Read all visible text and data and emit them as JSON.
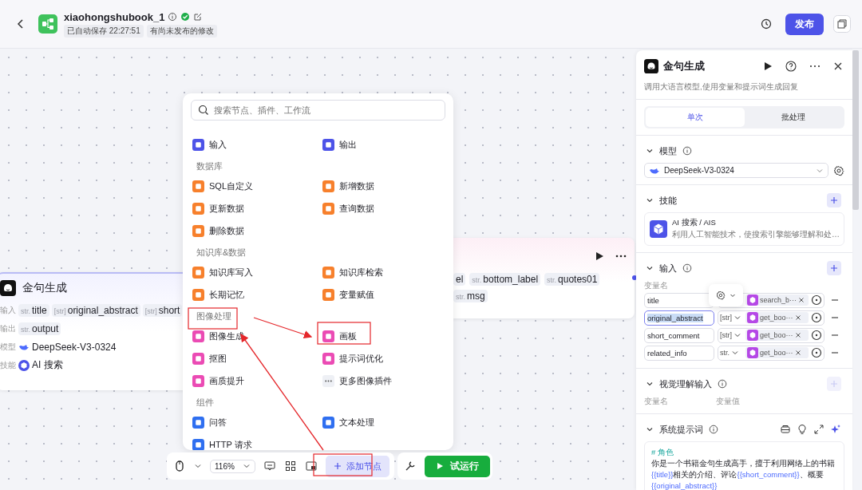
{
  "header": {
    "title": "xiaohongshubook_1",
    "autosave": "已自动保存 22:27:51",
    "status": "有尚未发布的修改",
    "publish": "发布"
  },
  "left_node": {
    "title": "金句生成",
    "rows": [
      {
        "label": "输入",
        "kind": "tags",
        "tags": [
          {
            "type": "str.",
            "name": "title"
          },
          {
            "type": "[str]",
            "name": "original_abstract"
          },
          {
            "type": "[str]",
            "name": "short"
          }
        ]
      },
      {
        "label": "输出",
        "kind": "tags",
        "tags": [
          {
            "type": "str.",
            "name": "output"
          }
        ]
      },
      {
        "label": "模型",
        "kind": "model",
        "value": "DeepSeek-V3-0324"
      },
      {
        "label": "技能",
        "kind": "skill",
        "value": "AI 搜索"
      }
    ]
  },
  "middle_node": {
    "tag_rows": [
      [
        {
          "name": "el"
        },
        {
          "type": "str.",
          "name": "bottom_label"
        },
        {
          "type": "str.",
          "name": "quotes01"
        }
      ],
      [
        {
          "type": "str.",
          "name": "msg"
        }
      ]
    ]
  },
  "node_menu": {
    "search_placeholder": "搜索节点、插件、工作流",
    "sections": [
      {
        "items": [
          {
            "label": "输入",
            "color": "#4d53e8",
            "kind": "node"
          },
          {
            "label": "输出",
            "color": "#4d53e8",
            "kind": "node"
          }
        ]
      },
      {
        "title": "数据库",
        "items": [
          {
            "label": "SQL自定义",
            "color": "#f7802c",
            "kind": "node"
          },
          {
            "label": "新增数据",
            "color": "#f7802c",
            "kind": "node"
          },
          {
            "label": "更新数据",
            "color": "#f7802c",
            "kind": "node"
          },
          {
            "label": "查询数据",
            "color": "#f7802c",
            "kind": "node"
          },
          {
            "label": "删除数据",
            "color": "#f7802c",
            "kind": "node"
          }
        ]
      },
      {
        "title": "知识库&数据",
        "items": [
          {
            "label": "知识库写入",
            "color": "#f7802c",
            "kind": "node"
          },
          {
            "label": "知识库检索",
            "color": "#f7802c",
            "kind": "node"
          },
          {
            "label": "长期记忆",
            "color": "#f7802c",
            "kind": "node"
          },
          {
            "label": "变量赋值",
            "color": "#f7802c",
            "kind": "node"
          }
        ]
      },
      {
        "title": "图像处理",
        "items": [
          {
            "label": "图像生成",
            "color": "#eb4bb4",
            "kind": "node"
          },
          {
            "label": "画板",
            "color": "#eb4bb4",
            "kind": "node"
          },
          {
            "label": "抠图",
            "color": "#eb4bb4",
            "kind": "node"
          },
          {
            "label": "提示词优化",
            "color": "#eb4bb4",
            "kind": "node"
          },
          {
            "label": "画质提升",
            "color": "#eb4bb4",
            "kind": "node"
          },
          {
            "label": "更多图像插件",
            "color": "#eef0f5",
            "kind": "more"
          }
        ]
      },
      {
        "title": "组件",
        "items": [
          {
            "label": "问答",
            "color": "#2f6ff0",
            "kind": "node"
          },
          {
            "label": "文本处理",
            "color": "#2f6ff0",
            "kind": "node"
          },
          {
            "label": "HTTP 请求",
            "color": "#2f6ff0",
            "kind": "node"
          }
        ]
      }
    ]
  },
  "toolbar": {
    "zoom": "116%",
    "add_node": "添加节点",
    "run": "试运行"
  },
  "panel": {
    "title": "金句生成",
    "description": "调用大语言模型,使用变量和提示词生成回复",
    "tabs": [
      {
        "label": "单次",
        "selected": true
      },
      {
        "label": "批处理",
        "selected": false
      }
    ],
    "model": {
      "title": "模型",
      "expanded": true,
      "value": "DeepSeek-V3-0324"
    },
    "skills": {
      "title": "技能",
      "expanded": true,
      "add_disabled": false,
      "items": [
        {
          "name": "AI 搜索 / AIS",
          "description": "利用人工智能技术，使搜索引擎能够理解和处…"
        }
      ]
    },
    "inputs": {
      "title": "输入",
      "expanded": true,
      "add_disabled": false,
      "name_header": "变量名",
      "rows": [
        {
          "name": "title",
          "ref": "search_b···",
          "focused": false
        },
        {
          "name": "original_abstract",
          "type": "[str]",
          "ref": "get_boo···",
          "focused": true
        },
        {
          "name": "short_comment",
          "type": "[str]",
          "ref": "get_boo···",
          "focused": false
        },
        {
          "name": "related_info",
          "type": "str.",
          "ref": "get_boo···",
          "focused": false
        }
      ]
    },
    "vision": {
      "title": "视觉理解输入",
      "expanded": true,
      "add_disabled": true,
      "name_header": "变量名",
      "value_header": "变量值"
    },
    "prompt": {
      "title": "系统提示词",
      "expanded": true,
      "heading": "# 角色",
      "segments": [
        {
          "kind": "plain",
          "text": "你是一个书籍金句生成高手，擅于利用网络上的书籍"
        },
        {
          "kind": "var",
          "text": "{{title}}"
        },
        {
          "kind": "plain",
          "text": "相关的介绍、评论"
        },
        {
          "kind": "var",
          "text": "{{short_comment}}"
        },
        {
          "kind": "plain",
          "text": "、概要"
        },
        {
          "kind": "var",
          "text": "{{original_abstract}}"
        }
      ]
    }
  }
}
